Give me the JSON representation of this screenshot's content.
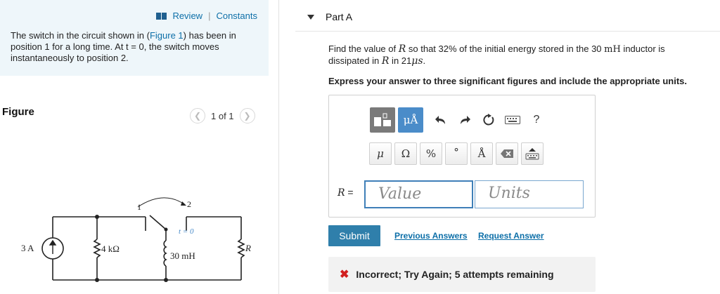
{
  "left": {
    "review": "Review",
    "separator": "|",
    "constants": "Constants",
    "intro_pre": "The switch in the circuit shown in (",
    "intro_link": "Figure 1",
    "intro_post": ") has been in position 1 for a long time. At t = 0, the switch moves instantaneously to position 2.",
    "figure_title": "Figure",
    "pager": "1 of 1",
    "circuit": {
      "source_label": "3 A",
      "r1_label": "4 kΩ",
      "inductor_label": "30 mH",
      "r2_label": "R",
      "pos1": "1",
      "pos2": "2",
      "time_label": "t = 0"
    }
  },
  "right": {
    "part": "Part A",
    "question_1": "Find the value of ",
    "var_R": "R",
    "question_2": " so that 32",
    "pct": "%",
    "question_3": " of the initial energy stored in the 30 ",
    "unit_mH": "mH",
    "question_4": " inductor is dissipated in ",
    "question_5": " in 21",
    "unit_us": "μs",
    "question_end": ".",
    "instruction": "Express your answer to three significant figures and include the appropriate units.",
    "toolbar": {
      "units_btn": "μÅ",
      "help": "?",
      "mu": "μ",
      "omega": "Ω",
      "percent": "%",
      "degree": "°",
      "angstrom": "Å"
    },
    "r_label": "R",
    "equals": " =",
    "value_placeholder": "Value",
    "units_placeholder": "Units",
    "submit": "Submit",
    "previous_answers": "Previous Answers",
    "request_answer": "Request Answer",
    "feedback": "Incorrect; Try Again; 5 attempts remaining",
    "colors": {
      "accent": "#2f7fab",
      "link": "#0d6fa8",
      "error": "#d11f1f"
    }
  }
}
